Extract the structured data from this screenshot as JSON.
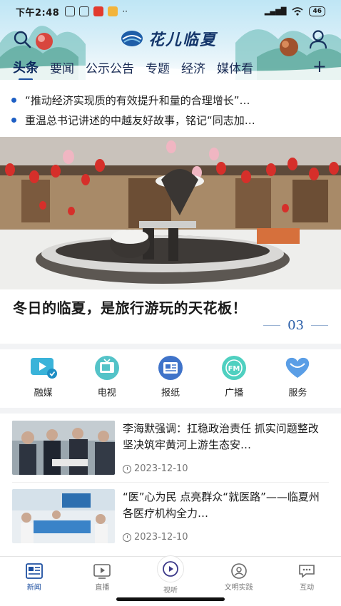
{
  "status": {
    "time": "下午2:48",
    "signal": "5G",
    "battery": "46"
  },
  "header": {
    "logo_text": "花儿临夏",
    "tabs": [
      {
        "label": "头条",
        "active": true
      },
      {
        "label": "要闻"
      },
      {
        "label": "公示公告"
      },
      {
        "label": "专题"
      },
      {
        "label": "经济"
      },
      {
        "label": "媒体看"
      }
    ],
    "add_label": "+"
  },
  "ticker": [
    "“推动经济实现质的有效提升和量的合理增长”…",
    "重温总书记讲述的中越友好故事，铭记“同志加…"
  ],
  "hero": {
    "title": "冬日的临夏，是旅行游玩的天花板！",
    "page": "03"
  },
  "quick_entries": [
    {
      "label": "融媒",
      "icon": "media-convergence-icon"
    },
    {
      "label": "电视",
      "icon": "tv-icon"
    },
    {
      "label": "报纸",
      "icon": "newspaper-icon"
    },
    {
      "label": "广播",
      "icon": "fm-radio-icon"
    },
    {
      "label": "服务",
      "icon": "heart-service-icon"
    }
  ],
  "news": [
    {
      "title": "李海默强调：扛稳政治责任 抓实问题整改 坚决筑牢黄河上游生态安…",
      "date": "2023-12-10"
    },
    {
      "title": "“医”心为民 点亮群众“就医路”——临夏州各医疗机构全力…",
      "date": "2023-12-10"
    }
  ],
  "bottom_nav": [
    {
      "label": "新闻",
      "icon": "news-icon",
      "active": true
    },
    {
      "label": "直播",
      "icon": "live-icon"
    },
    {
      "label": "视听",
      "icon": "play-icon"
    },
    {
      "label": "文明实践",
      "icon": "civilization-icon"
    },
    {
      "label": "互动",
      "icon": "chat-icon"
    }
  ],
  "colors": {
    "accent": "#1d4fa0",
    "ticker_dot": "#1e5fc4"
  }
}
